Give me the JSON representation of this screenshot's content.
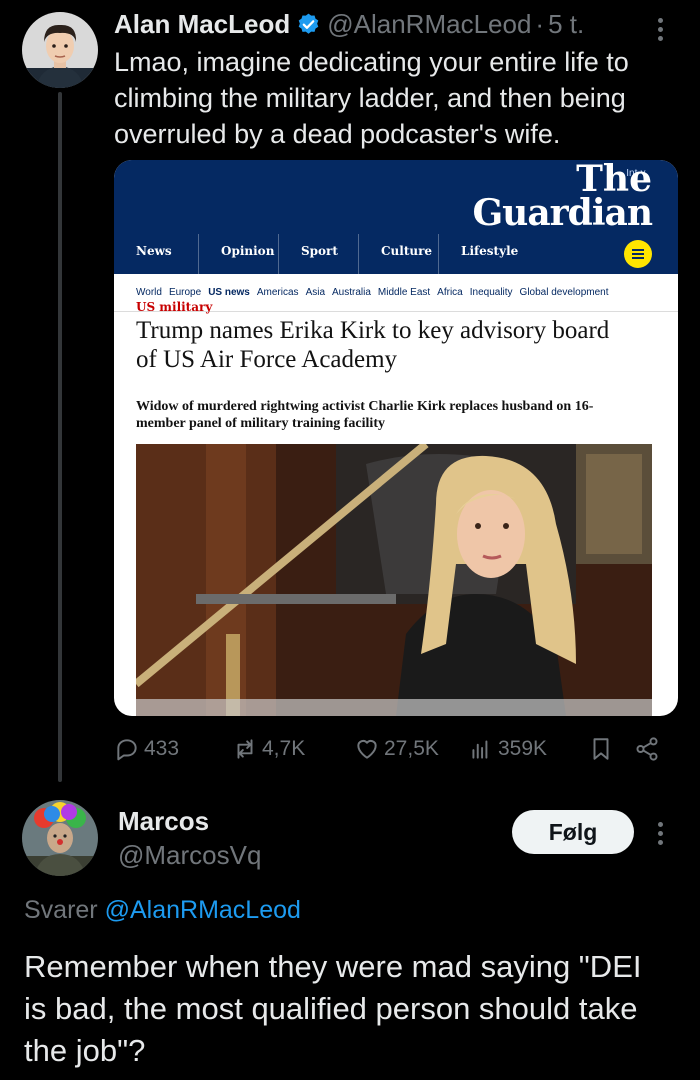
{
  "tweet1": {
    "author_name": "Alan MacLeod",
    "author_handle": "@AlanRMacLeod",
    "time": "5 t.",
    "text": "Lmao, imagine dedicating your entire life to climbing the military ladder, and then being overruled by a dead podcaster's wife.",
    "verified": true,
    "embed": {
      "edition": "Int",
      "logo_line1": "The",
      "logo_line2": "Guardian",
      "nav": [
        "News",
        "Opinion",
        "Sport",
        "Culture",
        "Lifestyle"
      ],
      "subnav": [
        "World",
        "Europe",
        "US news",
        "Americas",
        "Asia",
        "Australia",
        "Middle East",
        "Africa",
        "Inequality",
        "Global development"
      ],
      "subnav_active": "US news",
      "kicker": "US military",
      "headline": "Trump names Erika Kirk to key advisory board of US Air Force Academy",
      "standfirst": "Widow of murdered rightwing activist Charlie Kirk replaces husband on 16-member panel of military training facility"
    },
    "stats": {
      "replies": "433",
      "reposts": "4,7K",
      "likes": "27,5K",
      "views": "359K"
    }
  },
  "tweet2": {
    "author_name": "Marcos",
    "author_handle": "@MarcosVq",
    "follow_label": "Følg",
    "reply_prefix": "Svarer",
    "reply_to": "@AlanRMacLeod",
    "text": "Remember when they were mad saying \"DEI is bad, the most qualified person should take the job\"?"
  },
  "colors": {
    "background": "#000000",
    "text": "#e7e9ea",
    "muted": "#71767b",
    "link": "#1d9bf0",
    "guardian_blue": "#052962",
    "guardian_red": "#c70000"
  }
}
